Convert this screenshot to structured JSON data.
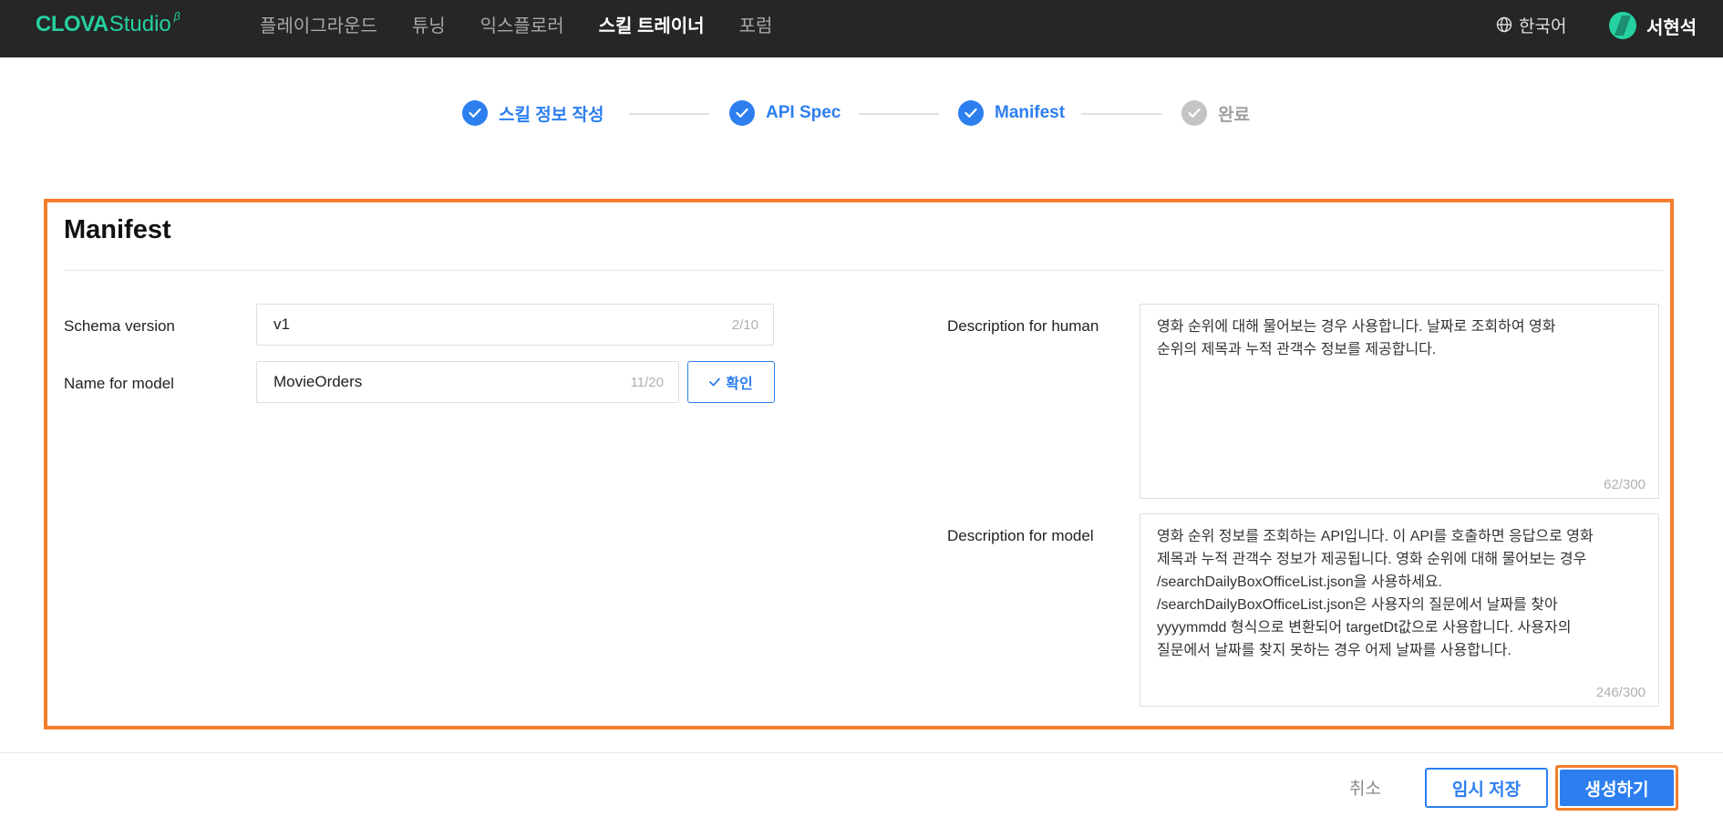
{
  "header": {
    "logo_main": "CLOVA",
    "logo_studio": "Studio",
    "logo_beta": "β",
    "nav_items": [
      {
        "label": "플레이그라운드",
        "active": false
      },
      {
        "label": "튜닝",
        "active": false
      },
      {
        "label": "익스플로러",
        "active": false
      },
      {
        "label": "스킬 트레이너",
        "active": true
      },
      {
        "label": "포럼",
        "active": false
      }
    ],
    "language": "한국어",
    "user_name": "서현석"
  },
  "stepper": {
    "steps": [
      {
        "label": "스킬 정보 작성",
        "status": "done"
      },
      {
        "label": "API Spec",
        "status": "done"
      },
      {
        "label": "Manifest",
        "status": "done"
      },
      {
        "label": "완료",
        "status": "pending"
      }
    ]
  },
  "manifest": {
    "title": "Manifest",
    "schema_version": {
      "label": "Schema version",
      "value": "v1",
      "counter": "2/10"
    },
    "name_for_model": {
      "label": "Name for model",
      "value": "MovieOrders",
      "counter": "11/20",
      "confirm_label": "확인"
    },
    "description_for_human": {
      "label": "Description for human",
      "value": "영화 순위에 대해 물어보는 경우 사용합니다. 날짜로 조회하여 영화\n순위의 제목과 누적 관객수 정보를 제공합니다.",
      "counter": "62/300"
    },
    "description_for_model": {
      "label": "Description for model",
      "value": "영화 순위 정보를 조회하는 API입니다. 이 API를 호출하면 응답으로 영화\n제목과 누적 관객수 정보가 제공됩니다. 영화 순위에 대해 물어보는 경우\n/searchDailyBoxOfficeList.json을 사용하세요.\n/searchDailyBoxOfficeList.json은 사용자의 질문에서 날짜를 찾아\nyyyymmdd 형식으로 변환되어 targetDt값으로 사용합니다. 사용자의\n질문에서 날짜를 찾지 못하는 경우 어제 날짜를 사용합니다.",
      "counter": "246/300"
    }
  },
  "footer": {
    "cancel_label": "취소",
    "temp_save_label": "임시 저장",
    "create_label": "생성하기"
  },
  "colors": {
    "accent": "#2d7ff0",
    "highlight_border": "#f57e2c",
    "topbar_bg": "#262626",
    "brand": "#25d1a0"
  }
}
